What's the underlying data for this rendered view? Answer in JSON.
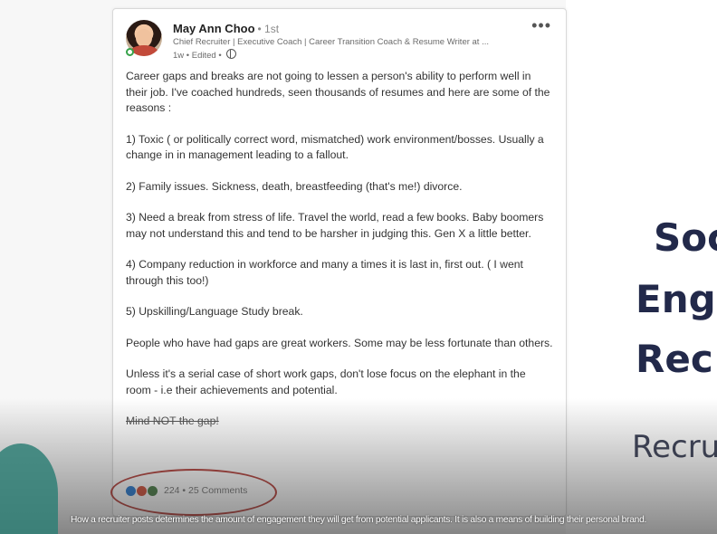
{
  "post": {
    "author_name": "May Ann Choo",
    "degree": "• 1st",
    "headline": "Chief Recruiter | Executive Coach | Career Transition Coach & Resume Writer at ...",
    "meta": "1w • Edited •",
    "paragraphs": [
      "Career gaps and breaks are not going to lessen a person's ability to perform well in their job. I've coached hundreds, seen thousands of resumes and here are some of the reasons :",
      "1) Toxic ( or politically correct word, mismatched) work environment/bosses. Usually a change in in management leading to a fallout.",
      "2) Family issues. Sickness, death, breastfeeding (that's me!) divorce.",
      "3) Need a break from stress of life. Travel the world, read a few books. Baby boomers may not understand this and tend to be harsher in judging this. Gen X a little better.",
      "4) Company reduction in workforce and many a times it is last in, first out. ( I went through this too!)",
      "5) Upskilling/Language Study break.",
      "People who have had gaps are great workers. Some may be less fortunate than others.",
      "Unless it's a serial case of short work gaps, don't lose focus on the elephant in the room - i.e their achievements and potential."
    ],
    "closing_line": "Mind NOT the gap!",
    "reactions_text": "224 • 25 Comments",
    "reaction_icons": [
      "like-icon",
      "love-icon",
      "support-icon"
    ]
  },
  "slide": {
    "line1": "Soc",
    "line2": "Eng",
    "line3": "Rec",
    "subtitle": "Recru"
  },
  "caption": "How a recruiter posts determines the amount of engagement they will get from potential applicants. It is also a means of building their personal brand.",
  "colors": {
    "slide_title": "#22294a",
    "highlight_circle": "#b6413b",
    "online_status": "#37a34a"
  }
}
